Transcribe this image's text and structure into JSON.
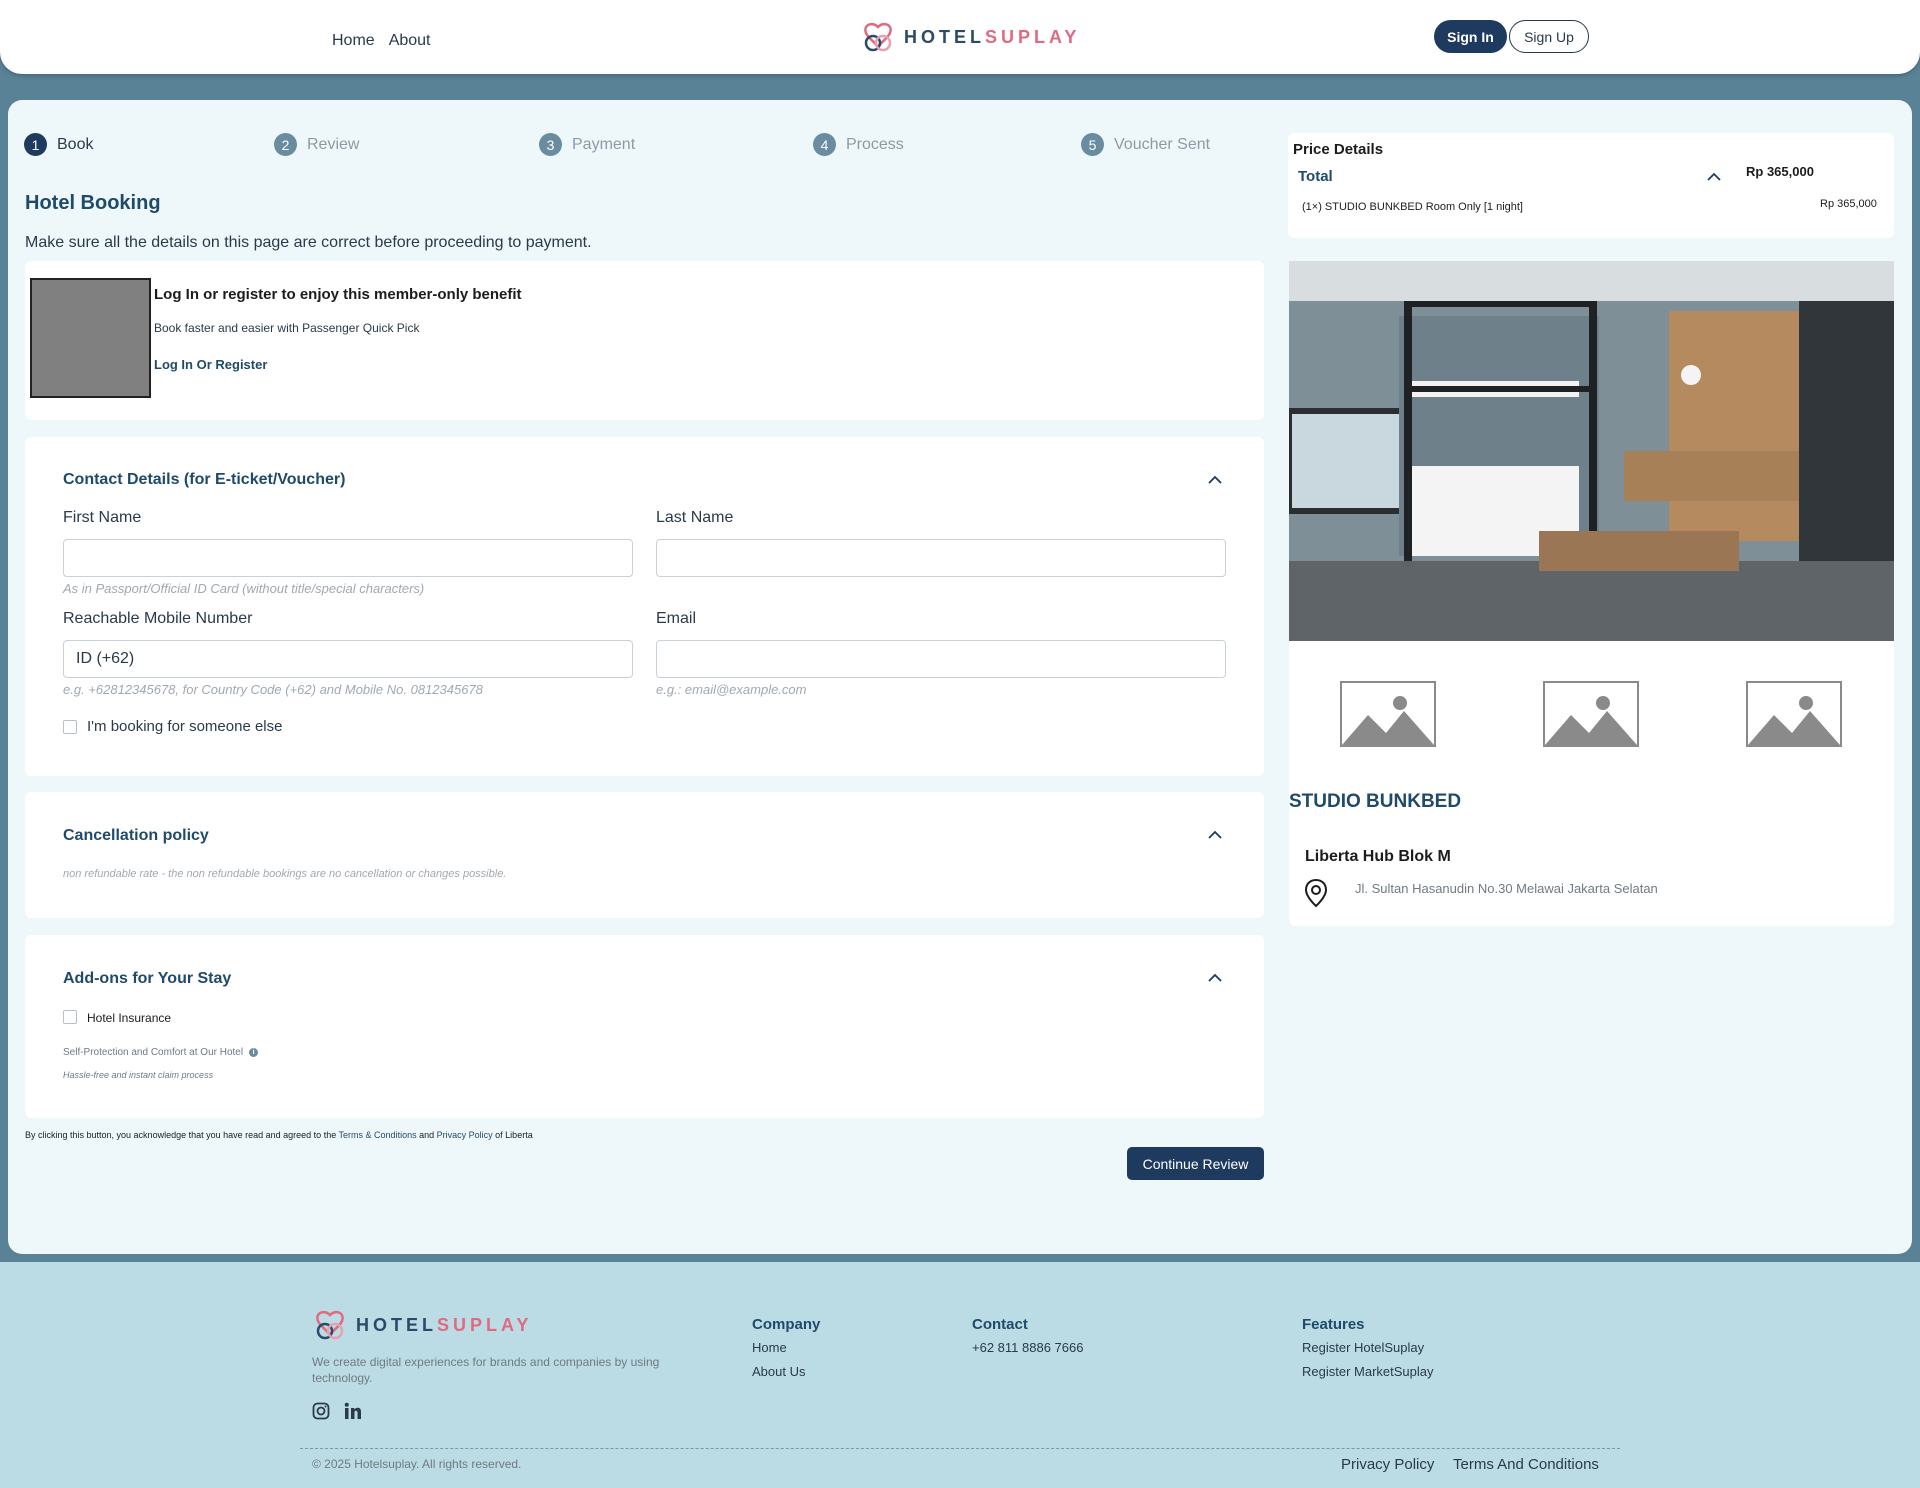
{
  "header": {
    "nav": [
      "Home",
      "About"
    ],
    "brand_part1": "HOTEL",
    "brand_part2": "SUPLAY",
    "sign_in": "Sign In",
    "sign_up": "Sign Up"
  },
  "steps": [
    {
      "num": "1",
      "label": "Book"
    },
    {
      "num": "2",
      "label": "Review"
    },
    {
      "num": "3",
      "label": "Payment"
    },
    {
      "num": "4",
      "label": "Process"
    },
    {
      "num": "5",
      "label": "Voucher Sent"
    }
  ],
  "booking": {
    "title": "Hotel Booking",
    "subtitle": "Make sure all the details on this page are correct before proceeding to payment."
  },
  "member": {
    "title": "Log In or register to enjoy this member-only benefit",
    "desc": "Book faster and easier with Passenger Quick Pick",
    "link": "Log In Or Register"
  },
  "contact": {
    "title": "Contact Details (for E-ticket/Voucher)",
    "first_name_label": "First Name",
    "last_name_label": "Last Name",
    "name_hint": "As in Passport/Official ID Card (without title/special characters)",
    "mobile_label": "Reachable Mobile Number",
    "mobile_value": "ID (+62)",
    "mobile_hint": "e.g. +62812345678, for Country Code (+62) and Mobile No. 0812345678",
    "email_label": "Email",
    "email_hint": "e.g.: email@example.com",
    "someone_else": "I'm booking for someone else"
  },
  "cancellation": {
    "title": "Cancellation policy",
    "text": "non refundable rate - the non refundable bookings are no cancellation or changes possible."
  },
  "addons": {
    "title": "Add-ons for Your Stay",
    "insurance": "Hotel Insurance",
    "protection": "Self-Protection and Comfort at Our Hotel",
    "claim": "Hassle-free and instant claim process"
  },
  "agreement": {
    "prefix": "By clicking this button, you acknowledge that you have read and agreed to the",
    "terms": "Terms & Conditions",
    "and": "and",
    "privacy": "Privacy Policy",
    "suffix": "of Liberta"
  },
  "continue_button": "Continue Review",
  "price": {
    "title": "Price Details",
    "total_label": "Total",
    "total_value": "Rp 365,000",
    "item": "(1×) STUDIO BUNKBED Room Only [1 night]",
    "item_value": "Rp 365,000"
  },
  "room": {
    "name": "STUDIO BUNKBED",
    "hotel": "Liberta Hub Blok M",
    "address": "Jl. Sultan Hasanudin No.30 Melawai Jakarta Selatan"
  },
  "footer": {
    "tagline": "We create digital experiences for brands and companies by using technology.",
    "company_head": "Company",
    "company_links": [
      "Home",
      "About Us"
    ],
    "contact_head": "Contact",
    "phone": "+62 811 8886 7666",
    "features_head": "Features",
    "features_links": [
      "Register HotelSuplay",
      "Register MarketSuplay"
    ],
    "copyright": "© 2025 Hotelsuplay. All rights reserved.",
    "privacy": "Privacy Policy",
    "terms": "Terms And Conditions"
  },
  "colors": {
    "primary": "#1f3a5f",
    "accent": "#e06a80",
    "page_bg": "#5a8296",
    "footer_bg": "#bbdce4"
  }
}
